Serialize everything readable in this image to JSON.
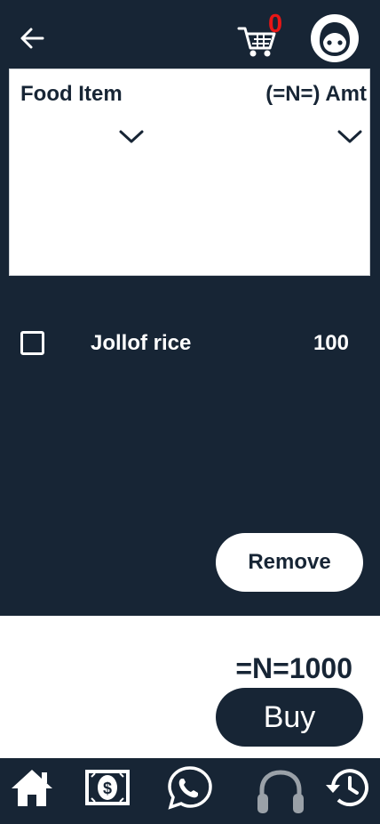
{
  "header": {
    "back_icon": "arrow-left-icon",
    "cart_icon": "shopping-cart-icon",
    "cart_count": "0",
    "avatar_icon": "face-avatar-icon"
  },
  "selector": {
    "food_label": "Food Item",
    "amount_label": "(=N=) Amt"
  },
  "items": [
    {
      "name": "Jollof rice",
      "amount": "100",
      "checked": false
    }
  ],
  "actions": {
    "remove_label": "Remove"
  },
  "checkout": {
    "total": "=N=1000",
    "buy_label": "Buy"
  },
  "bottom_nav": [
    {
      "icon": "home-icon"
    },
    {
      "icon": "money-icon"
    },
    {
      "icon": "whatsapp-icon"
    },
    {
      "icon": "headphones-icon"
    },
    {
      "icon": "history-icon"
    }
  ],
  "colors": {
    "background": "#172535",
    "panel": "#ffffff",
    "badge": "#e81616"
  }
}
